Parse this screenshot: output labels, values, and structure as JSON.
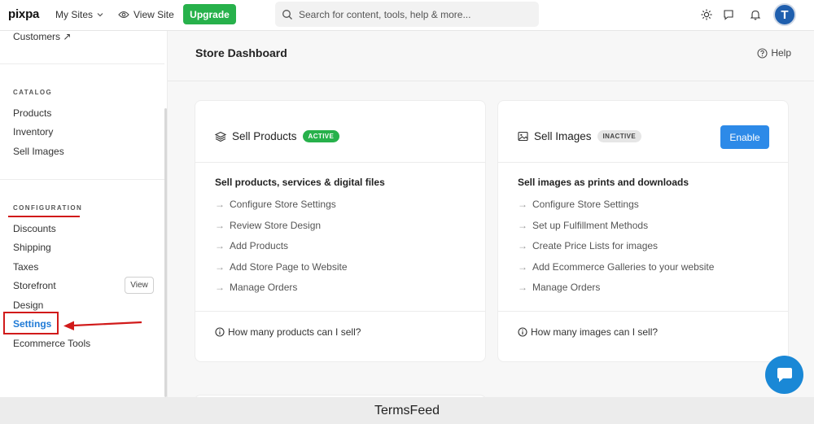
{
  "topbar": {
    "logo": "pixpa",
    "my_sites": "My Sites",
    "view_site": "View Site",
    "upgrade": "Upgrade",
    "search_placeholder": "Search for content, tools, help & more...",
    "avatar_initial": "T"
  },
  "sidebar": {
    "customers": "Customers ↗",
    "catalog_heading": "CATALOG",
    "catalog_items": [
      "Products",
      "Inventory",
      "Sell Images"
    ],
    "configuration_heading": "CONFIGURATION",
    "configuration_items": [
      "Discounts",
      "Shipping",
      "Taxes",
      "Storefront",
      "Design",
      "Settings",
      "Ecommerce Tools"
    ],
    "view_button": "View"
  },
  "main": {
    "title": "Store Dashboard",
    "help": "Help"
  },
  "cards": [
    {
      "title": "Sell Products",
      "badge": "ACTIVE",
      "subtitle": "Sell products, services & digital files",
      "steps": [
        "Configure Store Settings",
        "Review Store Design",
        "Add Products",
        "Add Store Page to Website",
        "Manage Orders"
      ],
      "question": "How many products can I sell?"
    },
    {
      "title": "Sell Images",
      "badge": "INACTIVE",
      "button": "Enable",
      "subtitle": "Sell images as prints and downloads",
      "steps": [
        "Configure Store Settings",
        "Set up Fulfillment Methods",
        "Create Price Lists for images",
        "Add Ecommerce Galleries to your website",
        "Manage Orders"
      ],
      "question": "How many images can I sell?"
    }
  ],
  "footer": "TermsFeed",
  "colors": {
    "upgrade_green": "#27b14b",
    "active_green": "#27b14b",
    "enable_blue": "#2d8ae8",
    "settings_blue": "#1f7ad6",
    "highlight_red": "#d11a1a",
    "chat_blue": "#1a88d6"
  }
}
